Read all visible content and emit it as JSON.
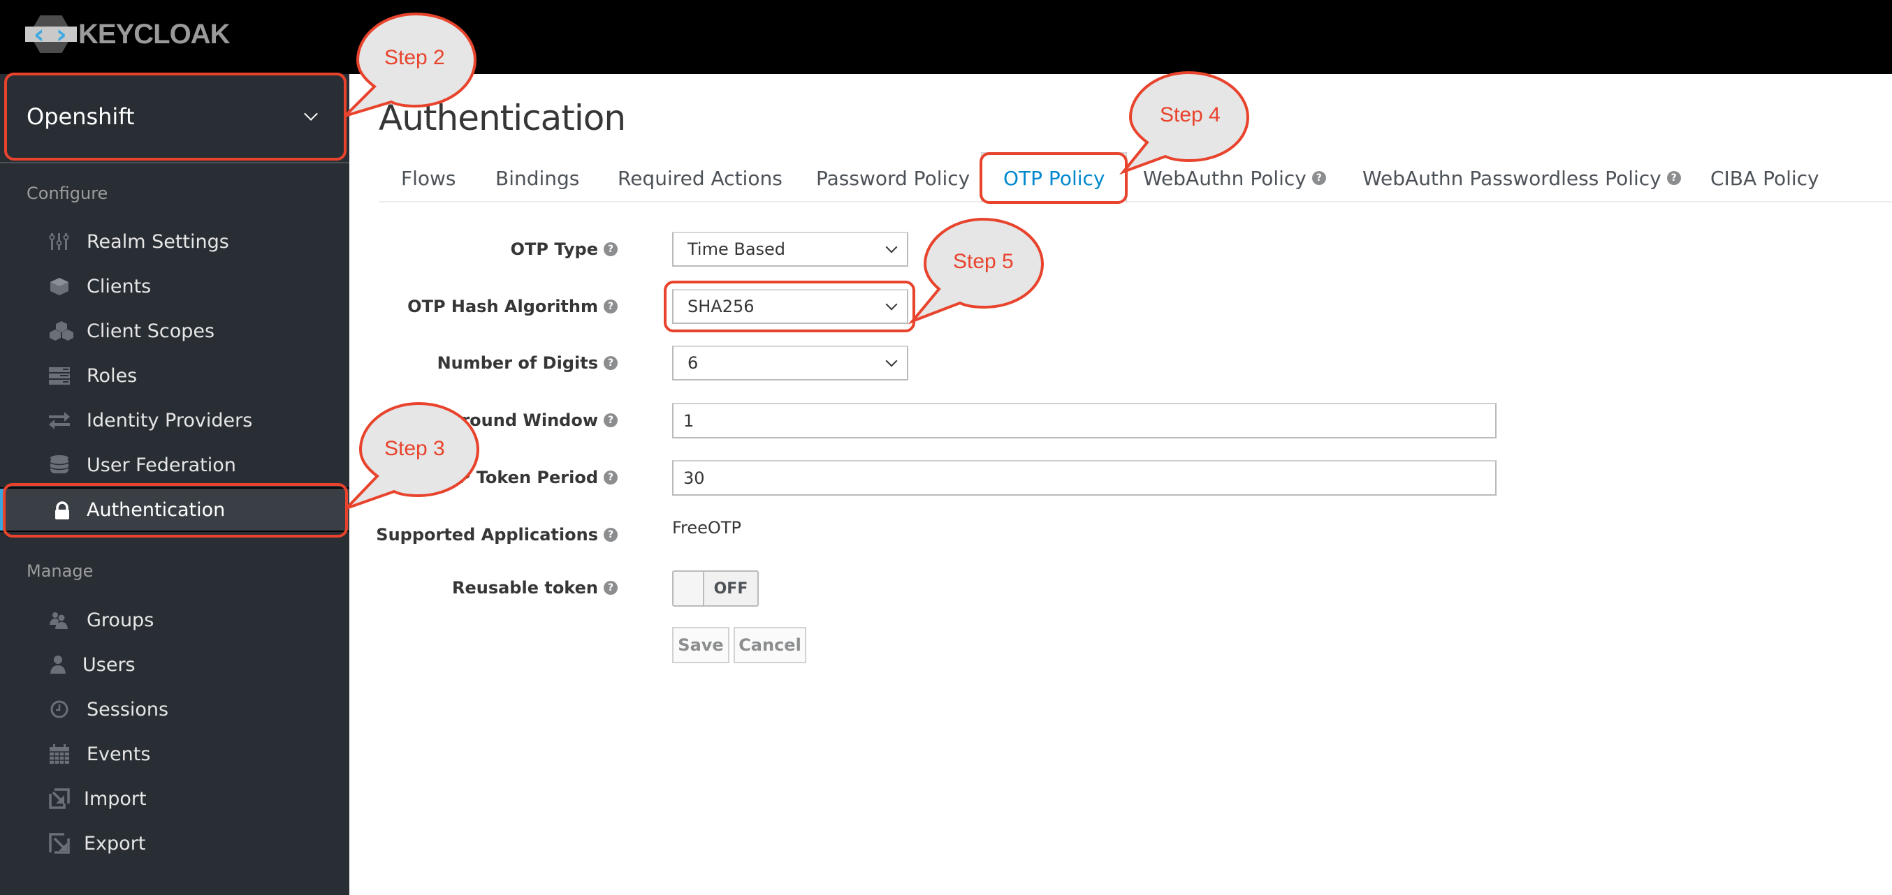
{
  "header": {
    "logo_text": "KEYCLOAK",
    "logo_icon": "keycloak-logo-icon"
  },
  "sidebar": {
    "realm": {
      "name": "Openshift",
      "icon": "chevron-down-icon"
    },
    "sections": [
      {
        "label": "Configure",
        "items": [
          {
            "label": "Realm Settings",
            "icon": "sliders-icon",
            "active": false
          },
          {
            "label": "Clients",
            "icon": "cube-icon",
            "active": false
          },
          {
            "label": "Client Scopes",
            "icon": "cubes-icon",
            "active": false
          },
          {
            "label": "Roles",
            "icon": "server-icon",
            "active": false
          },
          {
            "label": "Identity Providers",
            "icon": "exchange-icon",
            "active": false
          },
          {
            "label": "User Federation",
            "icon": "database-icon",
            "active": false
          },
          {
            "label": "Authentication",
            "icon": "lock-icon",
            "active": true
          }
        ]
      },
      {
        "label": "Manage",
        "items": [
          {
            "label": "Groups",
            "icon": "users-icon",
            "active": false
          },
          {
            "label": "Users",
            "icon": "user-icon",
            "active": false
          },
          {
            "label": "Sessions",
            "icon": "clock-icon",
            "active": false
          },
          {
            "label": "Events",
            "icon": "calendar-icon",
            "active": false
          },
          {
            "label": "Import",
            "icon": "import-icon",
            "active": false
          },
          {
            "label": "Export",
            "icon": "export-icon",
            "active": false
          }
        ]
      }
    ]
  },
  "main": {
    "title": "Authentication",
    "tabs": [
      {
        "label": "Flows",
        "active": false,
        "help": false
      },
      {
        "label": "Bindings",
        "active": false,
        "help": false
      },
      {
        "label": "Required Actions",
        "active": false,
        "help": false
      },
      {
        "label": "Password Policy",
        "active": false,
        "help": false
      },
      {
        "label": "OTP Policy",
        "active": true,
        "help": false
      },
      {
        "label": "WebAuthn Policy",
        "active": false,
        "help": true
      },
      {
        "label": "WebAuthn Passwordless Policy",
        "active": false,
        "help": true
      },
      {
        "label": "CIBA Policy",
        "active": false,
        "help": false
      }
    ],
    "form": {
      "otp_type": {
        "label": "OTP Type",
        "value": "Time Based"
      },
      "otp_hash_algorithm": {
        "label": "OTP Hash Algorithm",
        "value": "SHA256"
      },
      "number_of_digits": {
        "label": "Number of Digits",
        "value": "6"
      },
      "look_around_window": {
        "label": "Around Window",
        "value": "1"
      },
      "otp_token_period": {
        "label": "OTP Token Period",
        "value": "30"
      },
      "supported_applications": {
        "label": "Supported Applications",
        "value": "FreeOTP"
      },
      "reusable_token": {
        "label": "Reusable token",
        "state": "OFF"
      },
      "save_label": "Save",
      "cancel_label": "Cancel",
      "help_glyph": "?"
    }
  },
  "annotations": {
    "color": "#e8432c",
    "bubble_fill": "#e6e6e6",
    "steps": [
      "Step 2",
      "Step 3",
      "Step 4",
      "Step 5"
    ]
  },
  "colors": {
    "header_bg": "#000000",
    "sidebar_bg": "#292e34",
    "sidebar_active_bg": "#393f44",
    "active_accent": "#39a5dc",
    "tab_active": "#0088ce"
  }
}
